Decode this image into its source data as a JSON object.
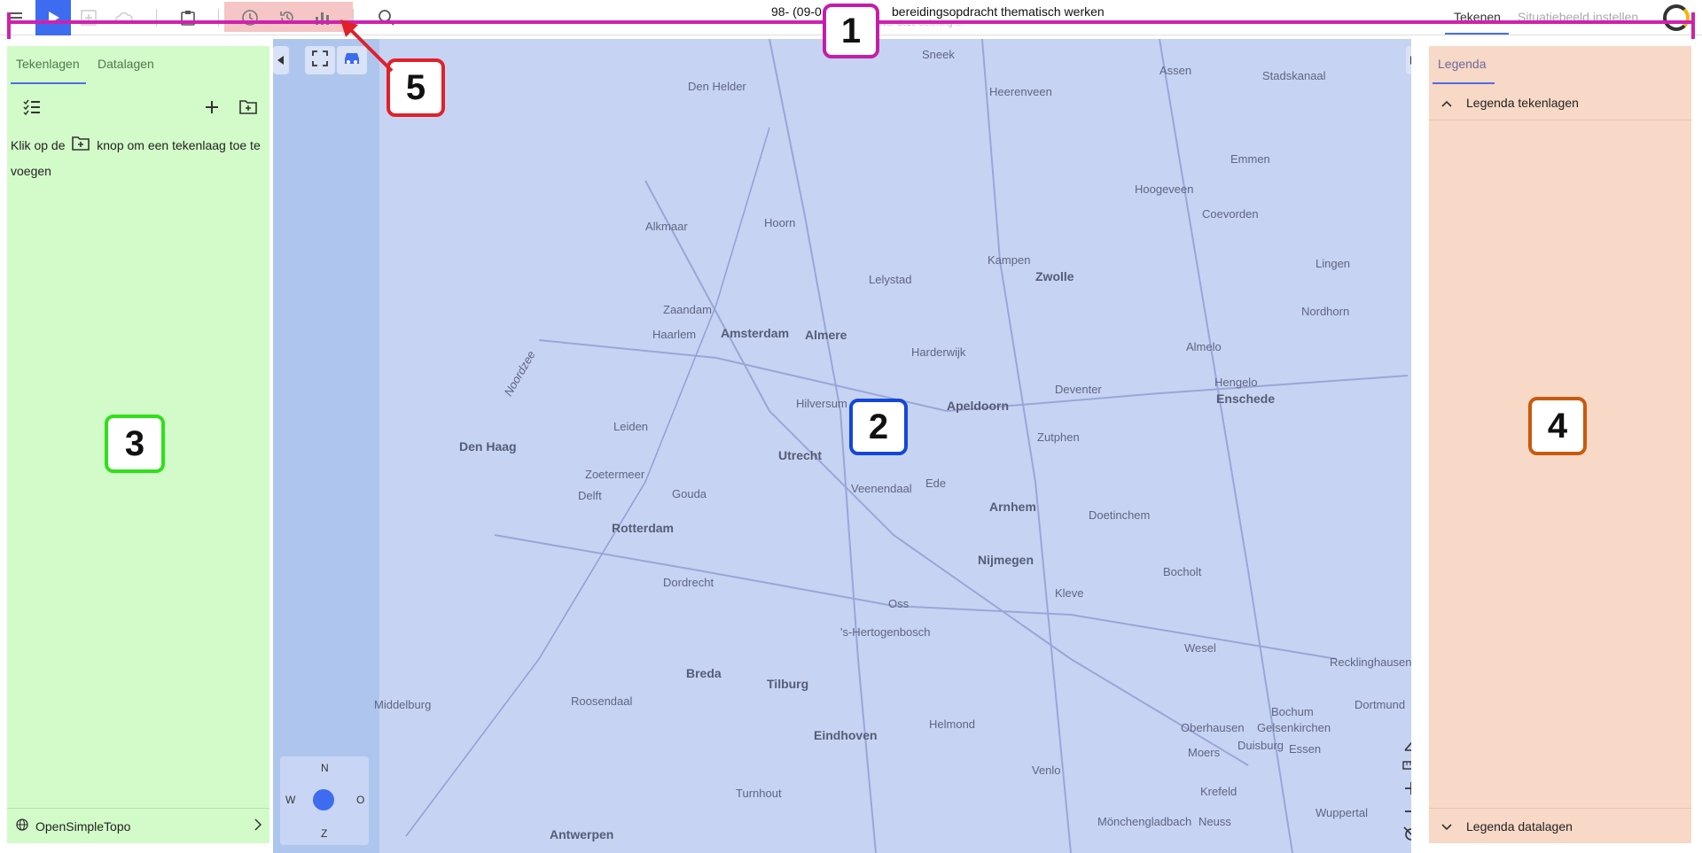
{
  "topbar": {
    "document_title": "98- (09-0",
    "document_title_rest": "bereidingsopdracht thematisch werken",
    "document_subtitle": "... lees meer over deze oefening ...",
    "tab_draw": "Tekenen",
    "tab_situation": "Situatiebeeld instellen",
    "icons": [
      "menu-icon",
      "play-icon",
      "add-tab-icon",
      "cloud-icon",
      "clipboard-icon",
      "clock-icon",
      "history-icon",
      "chart-icon",
      "search-icon"
    ]
  },
  "left_panel": {
    "tab_drawing_layers": "Tekenlagen",
    "tab_data_layers": "Datalagen",
    "hint_part1": "Klik op de",
    "hint_part2": "knop om een tekenlaag toe te voegen",
    "basemap_label": "OpenSimpleTopo"
  },
  "map": {
    "labels": [
      {
        "text": "Amsterdam",
        "big": true
      },
      {
        "text": "Almere",
        "big": true
      },
      {
        "text": "Haarlem",
        "big": false
      },
      {
        "text": "Utrecht",
        "big": true
      },
      {
        "text": "Den Haag",
        "big": true
      },
      {
        "text": "Rotterdam",
        "big": true
      },
      {
        "text": "Apeldoorn",
        "big": true
      },
      {
        "text": "Arnhem",
        "big": true
      },
      {
        "text": "Nijmegen",
        "big": true
      },
      {
        "text": "Zwolle",
        "big": true
      },
      {
        "text": "Enschede",
        "big": true
      },
      {
        "text": "Breda",
        "big": true
      },
      {
        "text": "Tilburg",
        "big": true
      },
      {
        "text": "Eindhoven",
        "big": true
      },
      {
        "text": "Antwerpen",
        "big": true
      },
      {
        "text": "Hilversum",
        "big": false
      },
      {
        "text": "Leiden",
        "big": false
      },
      {
        "text": "Dordrecht",
        "big": false
      },
      {
        "text": "'s-Hertogenbosch",
        "big": false
      },
      {
        "text": "Deventer",
        "big": false
      },
      {
        "text": "Hengelo",
        "big": false
      },
      {
        "text": "Emmen",
        "big": false
      },
      {
        "text": "Middelburg",
        "big": false
      },
      {
        "text": "Alkmaar",
        "big": false
      },
      {
        "text": "Zaandam",
        "big": false
      },
      {
        "text": "Lelystad",
        "big": false
      },
      {
        "text": "Noordzee",
        "big": false
      },
      {
        "text": "Venlo",
        "big": false
      },
      {
        "text": "Duisburg",
        "big": false
      },
      {
        "text": "Dortmund",
        "big": false
      },
      {
        "text": "Essen",
        "big": false
      },
      {
        "text": "Wesel",
        "big": false
      },
      {
        "text": "Kleve",
        "big": false
      },
      {
        "text": "Moers",
        "big": false
      },
      {
        "text": "Krefeld",
        "big": false
      },
      {
        "text": "Mönchengladbach",
        "big": false
      },
      {
        "text": "Neuss",
        "big": false
      },
      {
        "text": "Wuppertal",
        "big": false
      },
      {
        "text": "Bocholt",
        "big": false
      },
      {
        "text": "Almelo",
        "big": false
      },
      {
        "text": "Zutphen",
        "big": false
      },
      {
        "text": "Doetinchem",
        "big": false
      },
      {
        "text": "Kampen",
        "big": false
      },
      {
        "text": "Harderwijk",
        "big": false
      },
      {
        "text": "Ede",
        "big": false
      },
      {
        "text": "Veenendaal",
        "big": false
      },
      {
        "text": "Gouda",
        "big": false
      },
      {
        "text": "Zoetermeer",
        "big": false
      },
      {
        "text": "Delft",
        "big": false
      },
      {
        "text": "Roosendaal",
        "big": false
      },
      {
        "text": "Helmond",
        "big": false
      },
      {
        "text": "Oss",
        "big": false
      },
      {
        "text": "Turnhout",
        "big": false
      },
      {
        "text": "Hoorn",
        "big": false
      },
      {
        "text": "Den Helder",
        "big": false
      },
      {
        "text": "Sneek",
        "big": false
      },
      {
        "text": "Heerenveen",
        "big": false
      },
      {
        "text": "Assen",
        "big": false
      },
      {
        "text": "Stadskanaal",
        "big": false
      },
      {
        "text": "Hoogeveen",
        "big": false
      },
      {
        "text": "Coevorden",
        "big": false
      },
      {
        "text": "Lingen",
        "big": false
      },
      {
        "text": "Nordhorn",
        "big": false
      },
      {
        "text": "Recklinghausen",
        "big": false
      },
      {
        "text": "Oberhausen",
        "big": false
      },
      {
        "text": "Gelsenkirchen",
        "big": false
      },
      {
        "text": "Bochum",
        "big": false
      }
    ],
    "compass_n": "N",
    "compass_w": "W",
    "compass_o": "O",
    "compass_z": "Z"
  },
  "right_panel": {
    "tab_legend": "Legenda",
    "legend_drawing_layers": "Legenda tekenlagen",
    "legend_data_layers": "Legenda datalagen"
  },
  "annotations": {
    "badge_1": "1",
    "badge_2": "2",
    "badge_3": "3",
    "badge_4": "4",
    "badge_5": "5",
    "color_1": "#c41ea8",
    "color_2": "#1447d6",
    "color_3": "#2fe01a",
    "color_4": "#c95a0c",
    "color_5": "#e0202a"
  }
}
